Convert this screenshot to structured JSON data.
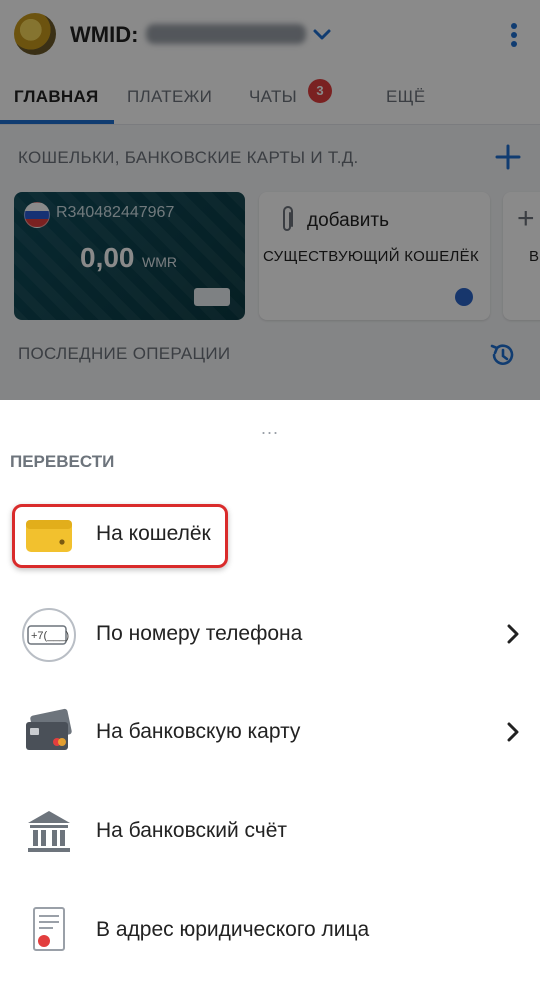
{
  "header": {
    "wmid_label": "WMID:",
    "wmid_value_obscured": "",
    "menu_icon": "kebab-icon"
  },
  "tabs": [
    {
      "label": "ГЛАВНАЯ",
      "active": true
    },
    {
      "label": "ПЛАТЕЖИ",
      "active": false
    },
    {
      "label": "ЧАТЫ",
      "active": false,
      "badge": "3"
    },
    {
      "label": "ЕЩЁ",
      "active": false
    }
  ],
  "wallets_section": {
    "title": "КОШЕЛЬКИ, БАНКОВСКИЕ КАРТЫ И Т.Д.",
    "wallet": {
      "number": "R340482447967",
      "amount": "0,00",
      "currency": "WMR"
    },
    "add_card": {
      "title": "добавить",
      "subtitle": "СУЩЕСТВУЮЩИЙ КОШЕЛЁК"
    },
    "third_card": {
      "plus": "+",
      "text": "В"
    }
  },
  "operations_section": {
    "title": "ПОСЛЕДНИЕ ОПЕРАЦИИ"
  },
  "sheet": {
    "handle": "...",
    "title": "ПЕРЕВЕСТИ",
    "items": [
      {
        "label": "На кошелёк",
        "icon": "wallet-icon",
        "has_chevron": false,
        "highlighted": true
      },
      {
        "label": "По номеру телефона",
        "icon": "phone-number-icon",
        "icon_text": "+7(___)",
        "has_chevron": true
      },
      {
        "label": "На банковскую карту",
        "icon": "bank-card-icon",
        "has_chevron": true
      },
      {
        "label": "На банковский счёт",
        "icon": "bank-building-icon",
        "has_chevron": false
      },
      {
        "label": "В адрес юридического лица",
        "icon": "document-icon",
        "has_chevron": false
      }
    ]
  },
  "colors": {
    "accent": "#1f6fd1",
    "badge": "#e23e3e",
    "highlight": "#d92b2b",
    "wallet_card": "#0f4b5a"
  }
}
